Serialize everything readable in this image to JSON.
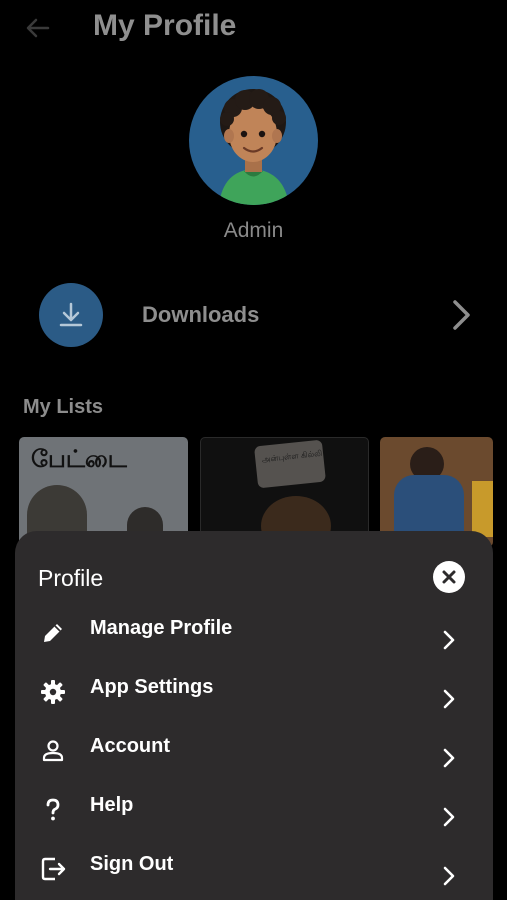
{
  "header": {
    "title": "My Profile",
    "back_icon": "arrow-left-icon"
  },
  "profile": {
    "username": "Admin",
    "avatar_icon": "avatar-icon"
  },
  "downloads": {
    "label": "Downloads",
    "icon": "download-icon"
  },
  "my_lists": {
    "title": "My Lists",
    "posters": [
      {
        "name": "poster-1",
        "title_text": "பேட்டை"
      },
      {
        "name": "poster-2",
        "title_text": "அன்புள்ள கில்லி"
      },
      {
        "name": "poster-3",
        "title_text": ""
      }
    ]
  },
  "sheet": {
    "title": "Profile",
    "close_icon": "close-icon",
    "items": [
      {
        "label": "Manage Profile",
        "icon": "pencil-icon"
      },
      {
        "label": "App Settings",
        "icon": "gear-icon"
      },
      {
        "label": "Account",
        "icon": "person-icon"
      },
      {
        "label": "Help",
        "icon": "question-icon"
      },
      {
        "label": "Sign Out",
        "icon": "sign-out-icon"
      }
    ]
  },
  "colors": {
    "background": "#000000",
    "sheet": "#2d2b2c",
    "accent": "#2b5b86",
    "text_primary": "#ffffff",
    "text_dim": "#8c8c8c"
  }
}
